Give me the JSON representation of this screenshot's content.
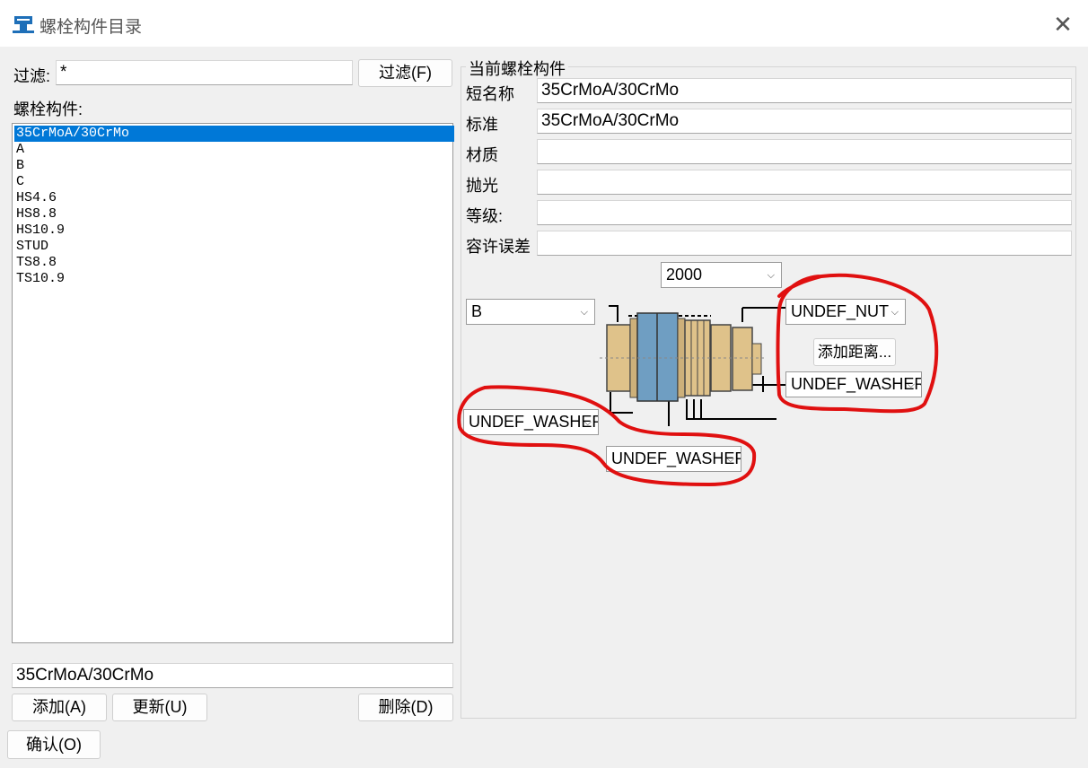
{
  "window": {
    "title": "螺栓构件目录",
    "close_symbol": "✕"
  },
  "filter": {
    "label": "过滤:",
    "value": "*",
    "button": "过滤(F)"
  },
  "list": {
    "label": "螺栓构件:",
    "items": [
      "35CrMoA/30CrMo",
      "A",
      "B",
      "C",
      "HS4.6",
      "HS8.8",
      "HS10.9",
      "STUD",
      "TS8.8",
      "TS10.9"
    ],
    "selected_index": 0,
    "name_value": "35CrMoA/30CrMo"
  },
  "buttons": {
    "add": "添加(A)",
    "update": "更新(U)",
    "delete": "删除(D)",
    "ok": "确认(O)"
  },
  "current": {
    "group_title": "当前螺栓构件",
    "fields": [
      {
        "label": "短名称",
        "value": "35CrMoA/30CrMo"
      },
      {
        "label": "标准",
        "value": "35CrMoA/30CrMo"
      },
      {
        "label": "材质",
        "value": ""
      },
      {
        "label": "抛光",
        "value": ""
      },
      {
        "label": "等级:",
        "value": ""
      },
      {
        "label": "容许误差",
        "value": ""
      }
    ]
  },
  "assembly": {
    "length_combo": "2000",
    "bolt_combo": "B",
    "nut_combo": "UNDEF_NUT",
    "add_distance_button": "添加距离...",
    "washer_right_combo": "UNDEF_WASHER",
    "washer_left_combo": "UNDEF_WASHER",
    "washer_bottom_combo": "UNDEF_WASHER",
    "chevron": "⌵"
  },
  "colors": {
    "selection": "#0078d7",
    "annotation": "#e01010",
    "part_tan": "#dfc28a",
    "plate_blue": "#6f9ec2"
  }
}
